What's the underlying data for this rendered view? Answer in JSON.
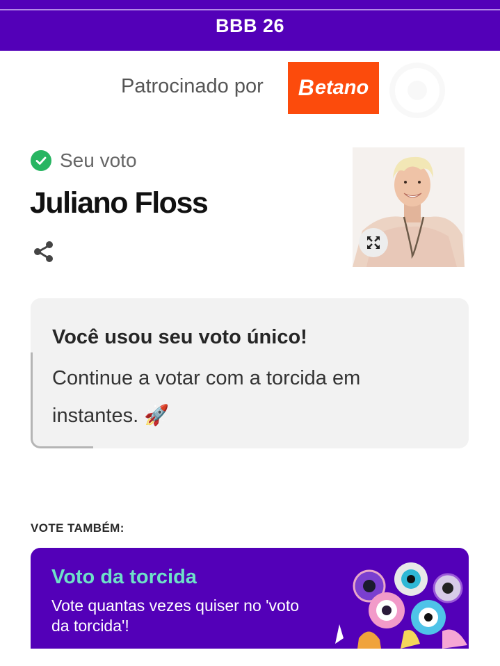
{
  "header": {
    "title": "BBB 26"
  },
  "sponsor": {
    "label": "Patrocinado por",
    "brand_b": "B",
    "brand_rest": "etano",
    "brand_color": "#fc4b0c"
  },
  "vote": {
    "status_label": "Seu voto",
    "check_icon": "check-circle-icon",
    "candidate_name": "Juliano Floss",
    "share_icon": "share-icon",
    "expand_icon": "expand-icon"
  },
  "info": {
    "heading": "Você usou seu voto único!",
    "body": "Continue a votar com a torcida em instantes. 🚀"
  },
  "also": {
    "label": "VOTE TAMBÉM:",
    "card_title": "Voto da torcida",
    "card_desc": "Vote quantas vezes quiser no 'voto da torcida'!"
  },
  "colors": {
    "brand_purple": "#5300b8",
    "accent_teal": "#6ee0c8",
    "check_green": "#27b561"
  }
}
